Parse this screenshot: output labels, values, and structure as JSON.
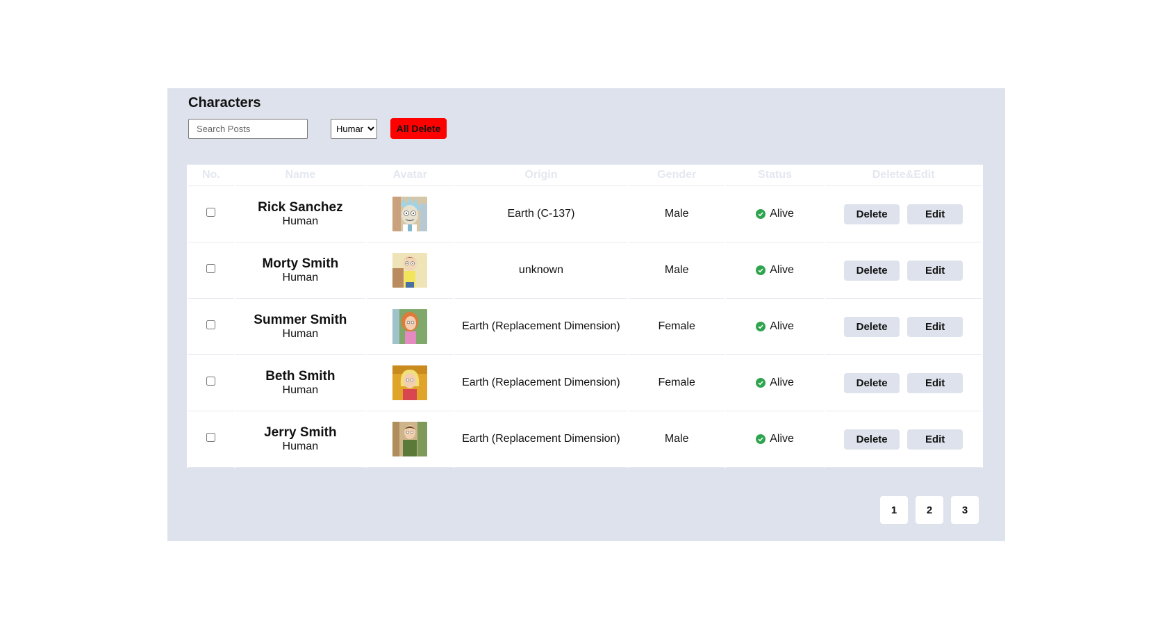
{
  "page": {
    "title": "Characters"
  },
  "toolbar": {
    "search_placeholder": "Search Posts",
    "species_filter": {
      "selected": "Human"
    },
    "all_delete_label": "All Delete"
  },
  "table": {
    "headers": {
      "no": "No.",
      "name": "Name",
      "avatar": "Avatar",
      "origin": "Origin",
      "gender": "Gender",
      "status": "Status",
      "actions": "Delete&Edit"
    },
    "rows": [
      {
        "name": "Rick Sanchez",
        "species": "Human",
        "origin": "Earth (C-137)",
        "gender": "Male",
        "status": "Alive",
        "avatar_icon": "rick-avatar-icon"
      },
      {
        "name": "Morty Smith",
        "species": "Human",
        "origin": "unknown",
        "gender": "Male",
        "status": "Alive",
        "avatar_icon": "morty-avatar-icon"
      },
      {
        "name": "Summer Smith",
        "species": "Human",
        "origin": "Earth (Replacement Dimension)",
        "gender": "Female",
        "status": "Alive",
        "avatar_icon": "summer-avatar-icon"
      },
      {
        "name": "Beth Smith",
        "species": "Human",
        "origin": "Earth (Replacement Dimension)",
        "gender": "Female",
        "status": "Alive",
        "avatar_icon": "beth-avatar-icon"
      },
      {
        "name": "Jerry Smith",
        "species": "Human",
        "origin": "Earth (Replacement Dimension)",
        "gender": "Male",
        "status": "Alive",
        "avatar_icon": "jerry-avatar-icon"
      }
    ],
    "delete_label": "Delete",
    "edit_label": "Edit"
  },
  "pagination": {
    "pages": [
      "1",
      "2",
      "3"
    ]
  },
  "colors": {
    "panel_bg": "#dde2ec",
    "danger": "#ff0000",
    "status_alive": "#2ea44f"
  }
}
